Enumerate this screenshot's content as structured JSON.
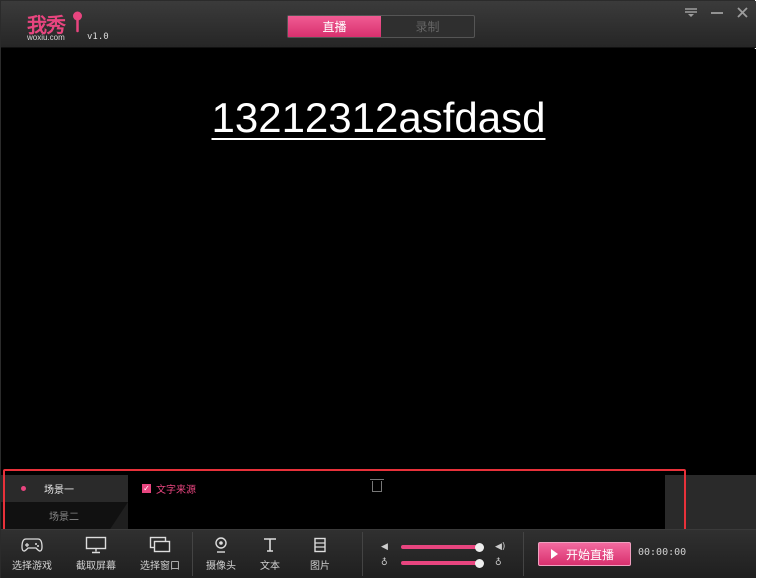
{
  "app": {
    "logo_text": "我秀",
    "logo_sub": "woxiu.com",
    "version": "v1.0"
  },
  "mode_switch": {
    "live_label": "直播",
    "record_label": "录制"
  },
  "window_controls": {
    "menu_icon": "menu-icon",
    "minimize_icon": "minimize-icon",
    "close_icon": "close-icon"
  },
  "stage": {
    "overlay_text": "13212312asfdasd"
  },
  "scenes": {
    "items": [
      {
        "label": "场景一",
        "active": true
      },
      {
        "label": "场景二",
        "active": false
      }
    ]
  },
  "sources": {
    "items": [
      {
        "label": "文字来源",
        "checked": true
      }
    ]
  },
  "toolbar": {
    "tools": [
      {
        "label": "选择游戏",
        "icon": "gamepad-icon"
      },
      {
        "label": "截取屏幕",
        "icon": "monitor-icon"
      },
      {
        "label": "选择窗口",
        "icon": "window-icon"
      },
      {
        "label": "摄像头",
        "icon": "webcam-icon"
      },
      {
        "label": "文本",
        "icon": "text-icon"
      },
      {
        "label": "图片",
        "icon": "image-icon"
      }
    ],
    "start_label": "开始直播",
    "timer": "00:00:00"
  },
  "audio": {
    "speaker_level": 1.0,
    "mic_level": 1.0
  },
  "colors": {
    "accent": "#e8457f",
    "highlight_box": "#e8313a"
  }
}
